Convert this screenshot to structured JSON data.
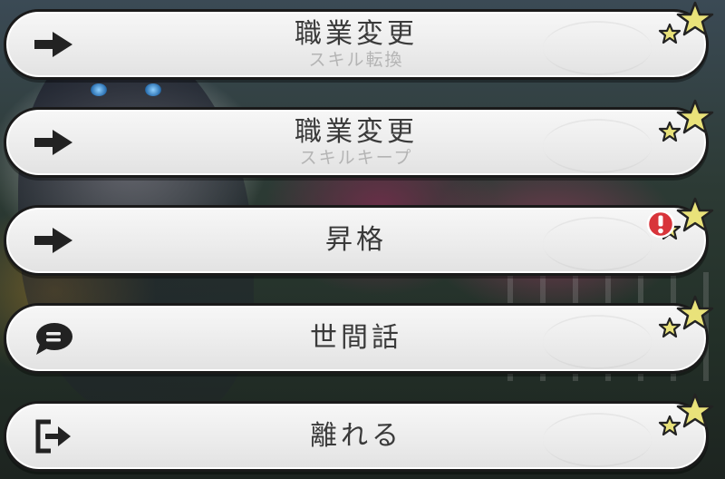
{
  "menu": {
    "items": [
      {
        "label": "職業変更",
        "sublabel": "スキル転換",
        "icon": "arrow-right-icon",
        "badge": null
      },
      {
        "label": "職業変更",
        "sublabel": "スキルキープ",
        "icon": "arrow-right-icon",
        "badge": null
      },
      {
        "label": "昇格",
        "sublabel": "",
        "icon": "arrow-right-icon",
        "badge": "alert"
      },
      {
        "label": "世間話",
        "sublabel": "",
        "icon": "chat-bubble-icon",
        "badge": null
      },
      {
        "label": "離れる",
        "sublabel": "",
        "icon": "exit-door-icon",
        "badge": null
      }
    ]
  },
  "colors": {
    "button_fill": "#ececec",
    "button_border": "#1a1a1a",
    "label_text": "#3a3a3a",
    "sublabel_text": "#b4b4b4",
    "star_fill": "#e9e27a",
    "alert_red": "#d8343a"
  }
}
